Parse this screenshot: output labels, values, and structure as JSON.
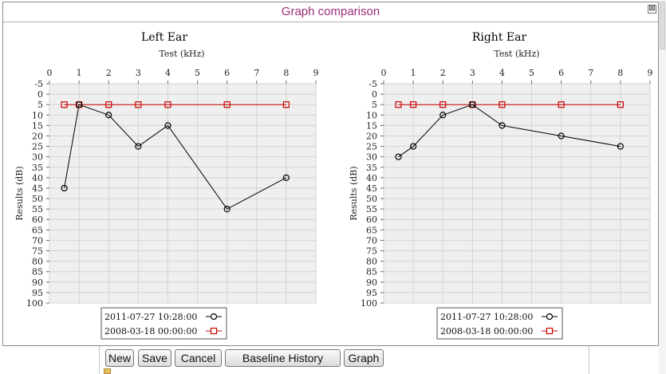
{
  "window": {
    "title": "Graph comparison",
    "close_glyph": "⊠"
  },
  "legend_items": [
    {
      "label": "2011-07-27 10:28:00",
      "marker": "circle",
      "color": "#000000"
    },
    {
      "label": "2008-03-18 00:00:00",
      "marker": "square",
      "color": "#cc0000"
    }
  ],
  "chart_data": [
    {
      "type": "line",
      "title": "Left Ear",
      "xlabel": "Test (kHz)",
      "ylabel": "Results (dB)",
      "xlim": [
        0,
        9
      ],
      "ylim": [
        -5,
        100
      ],
      "y_inverted": true,
      "x_ticks": [
        0,
        1,
        2,
        3,
        4,
        5,
        6,
        7,
        8,
        9
      ],
      "y_ticks": [
        -5,
        0,
        5,
        10,
        15,
        20,
        25,
        30,
        35,
        40,
        45,
        50,
        55,
        60,
        65,
        70,
        75,
        80,
        85,
        90,
        95,
        100
      ],
      "grid": true,
      "legend": "bottom-center",
      "series": [
        {
          "name": "2011-07-27 10:28:00",
          "marker": "circle",
          "color": "#000000",
          "x": [
            0.5,
            1,
            2,
            3,
            4,
            6,
            8
          ],
          "y": [
            45,
            5,
            10,
            25,
            15,
            55,
            40
          ]
        },
        {
          "name": "2008-03-18 00:00:00",
          "marker": "square",
          "color": "#cc0000",
          "x": [
            0.5,
            1,
            2,
            3,
            4,
            6,
            8
          ],
          "y": [
            5,
            5,
            5,
            5,
            5,
            5,
            5
          ]
        }
      ]
    },
    {
      "type": "line",
      "title": "Right Ear",
      "xlabel": "Test (kHz)",
      "ylabel": "Results (dB)",
      "xlim": [
        0,
        9
      ],
      "ylim": [
        -5,
        100
      ],
      "y_inverted": true,
      "x_ticks": [
        0,
        1,
        2,
        3,
        4,
        5,
        6,
        7,
        8,
        9
      ],
      "y_ticks": [
        -5,
        0,
        5,
        10,
        15,
        20,
        25,
        30,
        35,
        40,
        45,
        50,
        55,
        60,
        65,
        70,
        75,
        80,
        85,
        90,
        95,
        100
      ],
      "grid": true,
      "legend": "bottom-center",
      "series": [
        {
          "name": "2011-07-27 10:28:00",
          "marker": "circle",
          "color": "#000000",
          "x": [
            0.5,
            1,
            2,
            3,
            4,
            6,
            8
          ],
          "y": [
            30,
            25,
            10,
            5,
            15,
            20,
            25
          ]
        },
        {
          "name": "2008-03-18 00:00:00",
          "marker": "square",
          "color": "#cc0000",
          "x": [
            0.5,
            1,
            2,
            3,
            4,
            6,
            8
          ],
          "y": [
            5,
            5,
            5,
            5,
            5,
            5,
            5
          ]
        }
      ]
    }
  ],
  "toolbar": {
    "new_label": "New",
    "save_label": "Save",
    "cancel_label": "Cancel",
    "baseline_label": "Baseline History",
    "graph_label": "Graph"
  }
}
